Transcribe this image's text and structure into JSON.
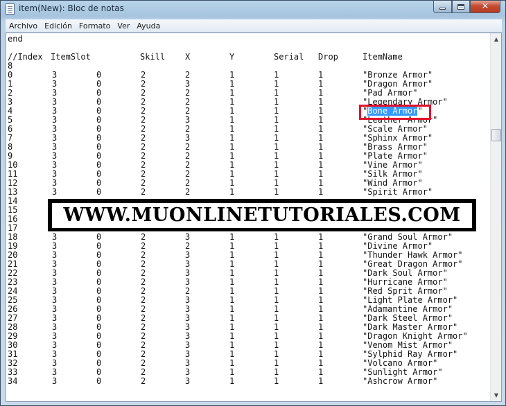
{
  "window": {
    "title": "item(New): Bloc de notas",
    "controls": {
      "minimize_icon": "minimize-icon",
      "maximize_icon": "maximize-icon",
      "close_glyph": "✕"
    }
  },
  "menu": [
    "Archivo",
    "Edición",
    "Formato",
    "Ver",
    "Ayuda"
  ],
  "editor": {
    "line_end": "end",
    "header": {
      "index": "//Index",
      "itemslot": "ItemSlot",
      "skill": "Skill",
      "x": "X",
      "y": "Y",
      "serial": "Serial",
      "drop": "Drop",
      "itemname": "ItemName"
    },
    "line_section": "8",
    "rows": [
      [
        "0",
        "3",
        "0",
        "2",
        "2",
        "1",
        "1",
        "1",
        "\"Bronze Armor\""
      ],
      [
        "1",
        "3",
        "0",
        "2",
        "3",
        "1",
        "1",
        "1",
        "\"Dragon Armor\""
      ],
      [
        "2",
        "3",
        "0",
        "2",
        "2",
        "1",
        "1",
        "1",
        "\"Pad Armor\""
      ],
      [
        "3",
        "3",
        "0",
        "2",
        "2",
        "1",
        "1",
        "1",
        "\"Legendary Armor\""
      ],
      [
        "4",
        "3",
        "0",
        "2",
        "2",
        "1",
        "1",
        "1",
        "\"Bone Armor\""
      ],
      [
        "5",
        "3",
        "0",
        "2",
        "3",
        "1",
        "1",
        "1",
        "\"Leather Armor\""
      ],
      [
        "6",
        "3",
        "0",
        "2",
        "2",
        "1",
        "1",
        "1",
        "\"Scale Armor\""
      ],
      [
        "7",
        "3",
        "0",
        "2",
        "3",
        "1",
        "1",
        "1",
        "\"Sphinx Armor\""
      ],
      [
        "8",
        "3",
        "0",
        "2",
        "2",
        "1",
        "1",
        "1",
        "\"Brass Armor\""
      ],
      [
        "9",
        "3",
        "0",
        "2",
        "2",
        "1",
        "1",
        "1",
        "\"Plate Armor\""
      ],
      [
        "10",
        "3",
        "0",
        "2",
        "2",
        "1",
        "1",
        "1",
        "\"Vine Armor\""
      ],
      [
        "11",
        "3",
        "0",
        "2",
        "2",
        "1",
        "1",
        "1",
        "\"Silk Armor\""
      ],
      [
        "12",
        "3",
        "0",
        "2",
        "2",
        "1",
        "1",
        "1",
        "\"Wind Armor\""
      ],
      [
        "13",
        "3",
        "0",
        "2",
        "2",
        "1",
        "1",
        "1",
        "\"Spirit Armor\""
      ],
      [
        "14",
        "",
        "",
        "",
        "",
        "",
        "",
        "",
        ""
      ],
      [
        "15",
        "",
        "",
        "",
        "",
        "",
        "",
        "",
        ""
      ],
      [
        "16",
        "",
        "",
        "",
        "",
        "",
        "",
        "",
        ""
      ],
      [
        "17",
        "",
        "",
        "",
        "",
        "",
        "",
        "",
        ""
      ],
      [
        "18",
        "3",
        "0",
        "2",
        "3",
        "1",
        "1",
        "1",
        "\"Grand Soul Armor\""
      ],
      [
        "19",
        "3",
        "0",
        "2",
        "2",
        "1",
        "1",
        "1",
        "\"Divine Armor\""
      ],
      [
        "20",
        "3",
        "0",
        "2",
        "3",
        "1",
        "1",
        "1",
        "\"Thunder Hawk Armor\""
      ],
      [
        "21",
        "3",
        "0",
        "2",
        "3",
        "1",
        "1",
        "1",
        "\"Great Dragon Armor\""
      ],
      [
        "22",
        "3",
        "0",
        "2",
        "3",
        "1",
        "1",
        "1",
        "\"Dark Soul Armor\""
      ],
      [
        "23",
        "3",
        "0",
        "2",
        "3",
        "1",
        "1",
        "1",
        "\"Hurricane Armor\""
      ],
      [
        "24",
        "3",
        "0",
        "2",
        "2",
        "1",
        "1",
        "1",
        "\"Red Sprit Armor\""
      ],
      [
        "25",
        "3",
        "0",
        "2",
        "3",
        "1",
        "1",
        "1",
        "\"Light Plate Armor\""
      ],
      [
        "26",
        "3",
        "0",
        "2",
        "3",
        "1",
        "1",
        "1",
        "\"Adamantine Armor\""
      ],
      [
        "27",
        "3",
        "0",
        "2",
        "3",
        "1",
        "1",
        "1",
        "\"Dark Steel Armor\""
      ],
      [
        "28",
        "3",
        "0",
        "2",
        "3",
        "1",
        "1",
        "1",
        "\"Dark Master Armor\""
      ],
      [
        "29",
        "3",
        "0",
        "2",
        "3",
        "1",
        "1",
        "1",
        "\"Dragon Knight Armor\""
      ],
      [
        "30",
        "3",
        "0",
        "2",
        "3",
        "1",
        "1",
        "1",
        "\"Venom Mist Armor\""
      ],
      [
        "31",
        "3",
        "0",
        "2",
        "3",
        "1",
        "1",
        "1",
        "\"Sylphid Ray Armor\""
      ],
      [
        "32",
        "3",
        "0",
        "2",
        "3",
        "1",
        "1",
        "1",
        "\"Volcano Armor\""
      ],
      [
        "33",
        "3",
        "0",
        "2",
        "3",
        "1",
        "1",
        "1",
        "\"Sunlight Armor\""
      ],
      [
        "34",
        "3",
        "0",
        "2",
        "3",
        "1",
        "1",
        "1",
        "\"Ashcrow Armor\""
      ]
    ],
    "selected_row_index": 4
  },
  "watermark": {
    "text": "WWW.MUONLINETUTORIALES.COM"
  },
  "colors": {
    "selection": "#3399ff",
    "highlight_border": "#e3102a",
    "banner": "#000000"
  }
}
